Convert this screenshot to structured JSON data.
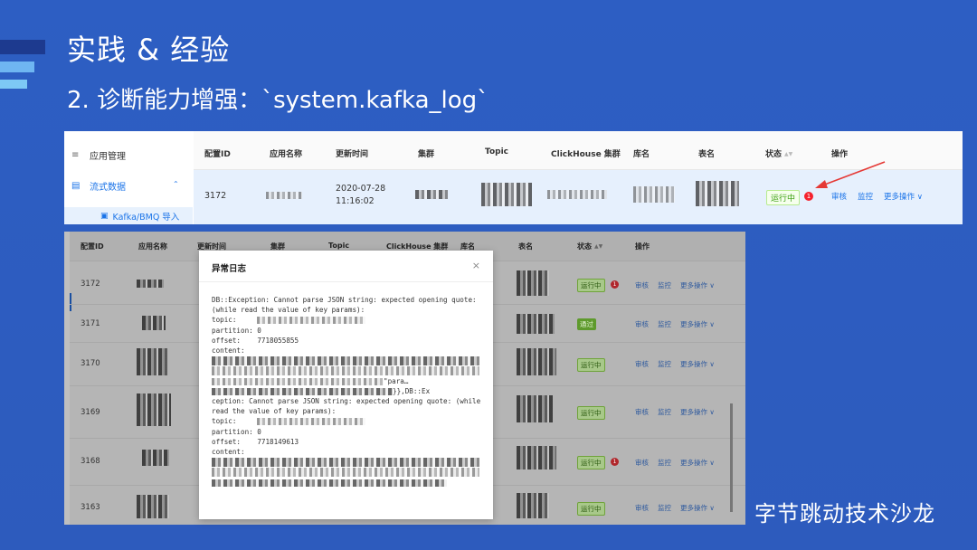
{
  "slide": {
    "title": "实践 & 经验",
    "subtitle": "2. 诊断能力增强：`system.kafka_log`",
    "brand": "字节跳动技术沙龙"
  },
  "top_panel": {
    "sidebar": {
      "items": [
        {
          "label": "应用管理",
          "icon": "list-icon"
        },
        {
          "label": "流式数据",
          "icon": "file-icon"
        }
      ],
      "sub_item": {
        "label": "Kafka/BMQ 导入",
        "icon": "folder-icon"
      }
    },
    "columns": [
      "配置ID",
      "应用名称",
      "更新时间",
      "集群",
      "Topic",
      "ClickHouse 集群",
      "库名",
      "表名",
      "状态",
      "操作"
    ],
    "row": {
      "id": "3172",
      "update_date": "2020-07-28",
      "update_time": "11:16:02",
      "status": "运行中",
      "badge": "1",
      "actions": [
        "审核",
        "监控",
        "更多操作 ∨"
      ]
    }
  },
  "bottom_panel": {
    "columns": [
      "配置ID",
      "应用名称",
      "更新时间",
      "集群",
      "Topic",
      "ClickHouse 集群",
      "库名",
      "表名",
      "状态",
      "操作"
    ],
    "rows": [
      {
        "id": "3172",
        "status": "运行中",
        "badge": "1",
        "actions": [
          "审核",
          "监控",
          "更多操作 ∨"
        ]
      },
      {
        "id": "3171",
        "status": "通过",
        "badge": "",
        "actions": [
          "审核",
          "监控",
          "更多操作 ∨"
        ]
      },
      {
        "id": "3170",
        "status": "运行中",
        "badge": "",
        "actions": [
          "审核",
          "监控",
          "更多操作 ∨"
        ]
      },
      {
        "id": "3169",
        "status": "运行中",
        "badge": "",
        "actions": [
          "审核",
          "监控",
          "更多操作 ∨"
        ]
      },
      {
        "id": "3168",
        "status": "运行中",
        "badge": "1",
        "actions": [
          "审核",
          "监控",
          "更多操作 ∨"
        ]
      },
      {
        "id": "3163",
        "status": "运行中",
        "badge": "",
        "actions": [
          "审核",
          "监控",
          "更多操作 ∨"
        ]
      }
    ]
  },
  "modal": {
    "title": "异常日志",
    "close": "×",
    "log": {
      "l1": "DB::Exception: Cannot parse JSON string: expected opening quote: (while read the value of key params):",
      "topic_label": "topic:",
      "partition1": "partition: 0",
      "offset1_label": "offset:",
      "offset1": "7718055855",
      "content_label": "content:",
      "params_frag": "\"para…",
      "ex_frag": "}},DB::Ex",
      "l2": "ception: Cannot parse JSON string: expected opening quote: (while read the value of key params):",
      "partition2": "partition: 0",
      "offset2": "7718149613"
    }
  },
  "colors": {
    "background": "#2d5ec3",
    "accent": "#1a73e8",
    "run_tag": "#389e0d",
    "badge": "#f5222d",
    "arrow": "#e53935"
  }
}
